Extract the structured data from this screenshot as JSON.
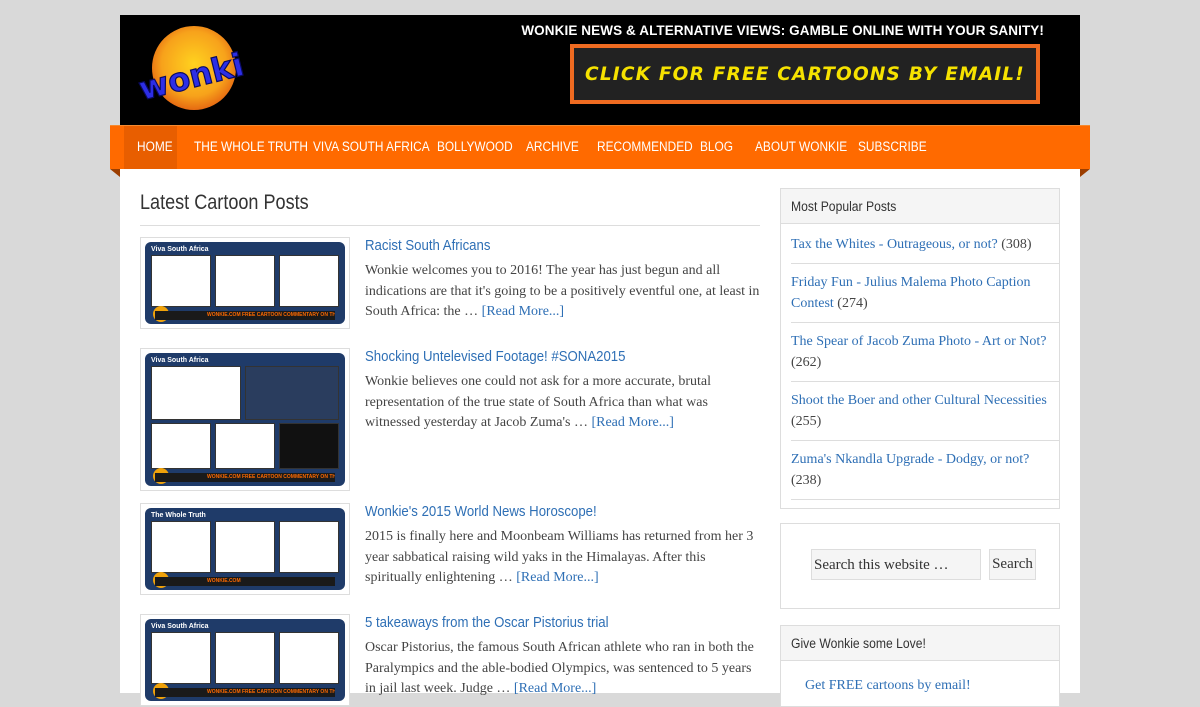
{
  "header": {
    "logo_text": "Wonkie",
    "tagline": "WONKIE NEWS & ALTERNATIVE VIEWS: GAMBLE ONLINE WITH YOUR SANITY!",
    "cta_label": "CLICK FOR FREE CARTOONS BY EMAIL!"
  },
  "nav": {
    "items": [
      {
        "label": "HOME"
      },
      {
        "label": "THE WHOLE TRUTH"
      },
      {
        "label": "VIVA SOUTH AFRICA"
      },
      {
        "label": "BOLLYWOOD"
      },
      {
        "label": "ARCHIVE"
      },
      {
        "label": "RECOMMENDED"
      },
      {
        "label": "BLOG"
      },
      {
        "label": "ABOUT WONKIE"
      },
      {
        "label": "SUBSCRIBE"
      }
    ]
  },
  "main": {
    "title": "Latest Cartoon Posts",
    "posts": [
      {
        "title": "Racist South Africans",
        "excerpt": "Wonkie welcomes you to 2016! The year has just begun and all indications are that it's going to be a positively eventful one, at least in South Africa: the … ",
        "read_more": "[Read More...]",
        "thumb_header": "Viva South Africa",
        "thumb_footer": "WONKIE.COM   FREE CARTOON COMMENTARY ON THE LATEST NEWS!"
      },
      {
        "title": "Shocking Untelevised Footage! #SONA2015",
        "excerpt": "Wonkie believes one could not ask for a more accurate, brutal representation of the true state of South Africa than what was witnessed yesterday at Jacob Zuma's … ",
        "read_more": "[Read More...]",
        "thumb_header": "Viva South Africa",
        "thumb_footer": "WONKIE.COM   FREE CARTOON COMMENTARY ON THE LATEST NEWS!"
      },
      {
        "title": "Wonkie's 2015 World News Horoscope!",
        "excerpt": "2015 is finally here and Moonbeam Williams has returned from her 3 year sabbatical raising wild yaks in the Himalayas. After this spiritually enlightening … ",
        "read_more": "[Read More...]",
        "thumb_header": "The Whole Truth",
        "thumb_footer": "WONKIE.COM"
      },
      {
        "title": "5 takeaways from the Oscar Pistorius trial",
        "excerpt": "Oscar Pistorius, the famous South African athlete who ran in both the Paralympics and the able-bodied Olympics, was sentenced to 5 years in jail last week. Judge … ",
        "read_more": "[Read More...]",
        "thumb_header": "Viva South Africa",
        "thumb_footer": "WONKIE.COM   FREE CARTOON COMMENTARY ON THE LATEST NEWS!"
      }
    ]
  },
  "sidebar": {
    "popular": {
      "title": "Most Popular Posts",
      "items": [
        {
          "title": "Tax the Whites - Outrageous, or not?",
          "count": "(308)"
        },
        {
          "title": "Friday Fun - Julius Malema Photo Caption Contest",
          "count": "(274)"
        },
        {
          "title": "The Spear of Jacob Zuma Photo - Art or Not?",
          "count": "(262)"
        },
        {
          "title": "Shoot the Boer and other Cultural Necessities",
          "count": "(255)"
        },
        {
          "title": "Zuma's Nkandla Upgrade - Dodgy, or not?",
          "count": "(238)"
        }
      ]
    },
    "search": {
      "placeholder": "Search this website …",
      "button_label": "Search"
    },
    "love": {
      "title": "Give Wonkie some Love!",
      "link": "Get FREE cartoons by email!"
    }
  },
  "colors": {
    "nav_orange": "#ff6a00",
    "link_blue": "#2e6fb5",
    "cta_text": "#f6e200",
    "header_bg": "#000000"
  }
}
